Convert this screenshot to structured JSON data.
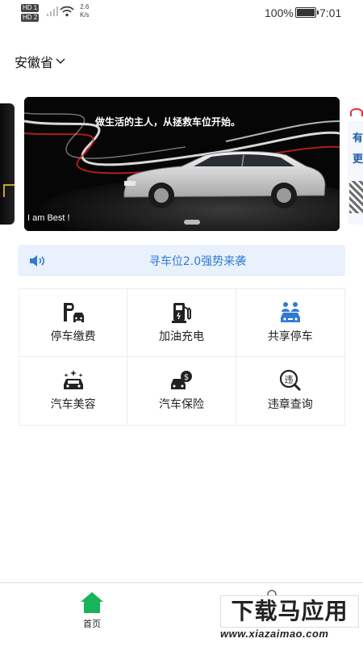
{
  "status_bar": {
    "sim1": "HD 1",
    "sim2": "HD 2",
    "net_speed_value": "2.6",
    "net_speed_unit": "K/s",
    "battery_percent": "100%",
    "time": "7:01"
  },
  "header": {
    "province": "安徽省"
  },
  "banner": {
    "slogan": "做生活的主人，从拯救车位开始。",
    "tagline": "I am Best !",
    "right_peek_chars": [
      "有",
      "更"
    ]
  },
  "notice": {
    "text": "寻车位2.0强势来袭"
  },
  "services": [
    {
      "label": "停车缴费",
      "icon": "parking-car-icon"
    },
    {
      "label": "加油充电",
      "icon": "fuel-pump-icon"
    },
    {
      "label": "共享停车",
      "icon": "shared-parking-icon"
    },
    {
      "label": "汽车美容",
      "icon": "car-sparkle-icon"
    },
    {
      "label": "汽车保险",
      "icon": "car-dollar-icon"
    },
    {
      "label": "违章查询",
      "icon": "violation-search-icon"
    }
  ],
  "tabbar": {
    "home_label": "首页"
  },
  "watermark": {
    "brand": "下载马应用",
    "url": "www.xiazaimao.com"
  },
  "colors": {
    "accent_blue": "#2f7bd4",
    "notice_bg": "#e8f1fc",
    "home_green": "#19b35a"
  }
}
